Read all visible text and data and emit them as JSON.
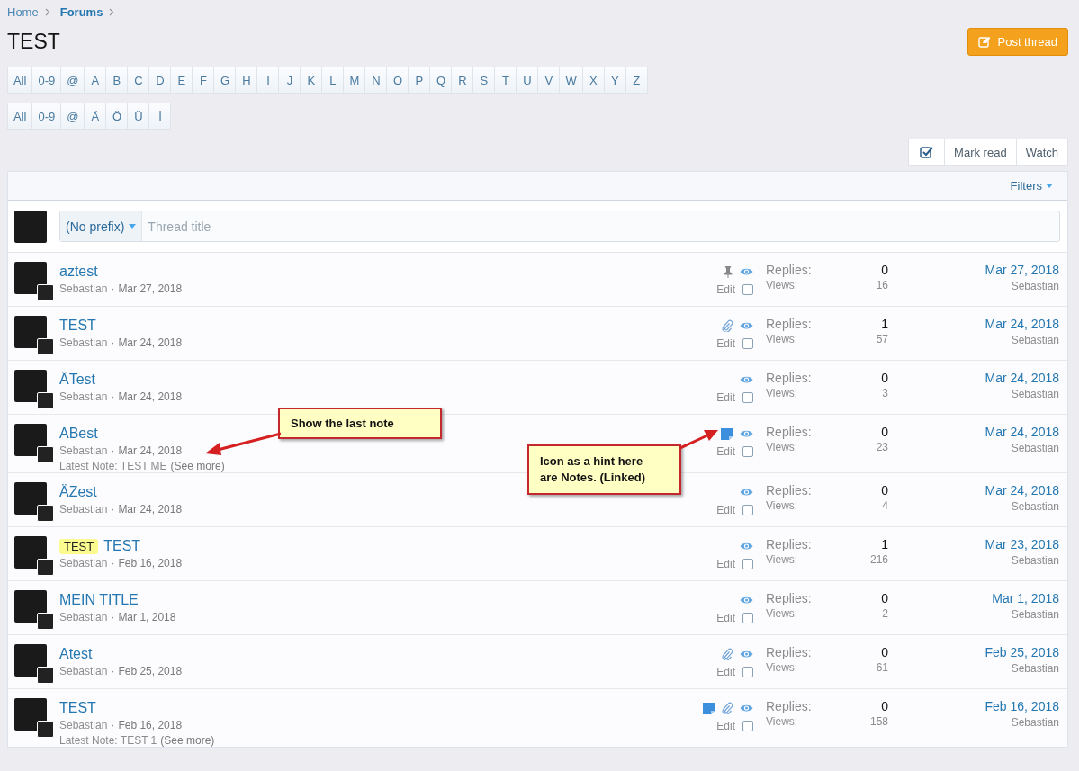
{
  "breadcrumb": [
    {
      "label": "Home",
      "current": false
    },
    {
      "label": "Forums",
      "current": true
    }
  ],
  "title": "TEST",
  "post_button": "Post thread",
  "letter_rows": [
    [
      "All",
      "0-9",
      "@",
      "A",
      "B",
      "C",
      "D",
      "E",
      "F",
      "G",
      "H",
      "I",
      "J",
      "K",
      "L",
      "M",
      "N",
      "O",
      "P",
      "Q",
      "R",
      "S",
      "T",
      "U",
      "V",
      "W",
      "X",
      "Y",
      "Z"
    ],
    [
      "All",
      "0-9",
      "@",
      "Ä",
      "Ö",
      "Ü",
      "İ"
    ]
  ],
  "toolbar": {
    "mark_read": "Mark read",
    "watch": "Watch"
  },
  "filters": "Filters",
  "new_thread": {
    "prefix": "(No prefix)",
    "placeholder": "Thread title"
  },
  "threads": [
    {
      "title": "aztest",
      "author": "Sebastian",
      "separator": "·",
      "date": "Mar 27, 2018",
      "pinned": true,
      "has_attachment": false,
      "has_note": false,
      "edit": "Edit",
      "checked": false,
      "replies_label": "Replies:",
      "replies": "0",
      "views_label": "Views:",
      "views": "16",
      "last_date": "Mar 27, 2018",
      "last_user": "Sebastian"
    },
    {
      "title": "TEST",
      "author": "Sebastian",
      "separator": "·",
      "date": "Mar 24, 2018",
      "pinned": false,
      "has_attachment": true,
      "has_note": false,
      "edit": "Edit",
      "checked": false,
      "replies_label": "Replies:",
      "replies": "1",
      "views_label": "Views:",
      "views": "57",
      "last_date": "Mar 24, 2018",
      "last_user": "Sebastian"
    },
    {
      "title": "ÄTest",
      "author": "Sebastian",
      "separator": "·",
      "date": "Mar 24, 2018",
      "pinned": false,
      "has_attachment": false,
      "has_note": false,
      "edit": "Edit",
      "checked": false,
      "replies_label": "Replies:",
      "replies": "0",
      "views_label": "Views:",
      "views": "3",
      "last_date": "Mar 24, 2018",
      "last_user": "Sebastian"
    },
    {
      "title": "ABest",
      "author": "Sebastian",
      "separator": "·",
      "date": "Mar 24, 2018",
      "note": {
        "text": "Latest Note: TEST ME",
        "link": "(See more)"
      },
      "pinned": false,
      "has_attachment": false,
      "has_note": true,
      "edit": "Edit",
      "checked": false,
      "replies_label": "Replies:",
      "replies": "0",
      "views_label": "Views:",
      "views": "23",
      "last_date": "Mar 24, 2018",
      "last_user": "Sebastian"
    },
    {
      "title": "ÄZest",
      "author": "Sebastian",
      "separator": "·",
      "date": "Mar 24, 2018",
      "pinned": false,
      "has_attachment": false,
      "has_note": false,
      "edit": "Edit",
      "checked": false,
      "replies_label": "Replies:",
      "replies": "0",
      "views_label": "Views:",
      "views": "4",
      "last_date": "Mar 24, 2018",
      "last_user": "Sebastian"
    },
    {
      "prefix": "TEST",
      "title": "TEST",
      "author": "Sebastian",
      "separator": "·",
      "date": "Feb 16, 2018",
      "pinned": false,
      "has_attachment": false,
      "has_note": false,
      "edit": "Edit",
      "checked": false,
      "replies_label": "Replies:",
      "replies": "1",
      "views_label": "Views:",
      "views": "216",
      "last_date": "Mar 23, 2018",
      "last_user": "Sebastian"
    },
    {
      "title": "MEIN TITLE",
      "author": "Sebastian",
      "separator": "·",
      "date": "Mar 1, 2018",
      "pinned": false,
      "has_attachment": false,
      "has_note": false,
      "edit": "Edit",
      "checked": false,
      "replies_label": "Replies:",
      "replies": "0",
      "views_label": "Views:",
      "views": "2",
      "last_date": "Mar 1, 2018",
      "last_user": "Sebastian"
    },
    {
      "title": "Atest",
      "author": "Sebastian",
      "separator": "·",
      "date": "Feb 25, 2018",
      "pinned": false,
      "has_attachment": true,
      "has_note": false,
      "edit": "Edit",
      "checked": false,
      "replies_label": "Replies:",
      "replies": "0",
      "views_label": "Views:",
      "views": "61",
      "last_date": "Feb 25, 2018",
      "last_user": "Sebastian"
    },
    {
      "title": "TEST",
      "author": "Sebastian",
      "separator": "·",
      "date": "Feb 16, 2018",
      "note": {
        "text": "Latest Note: TEST 1",
        "link": "(See more)"
      },
      "pinned": false,
      "has_attachment": true,
      "has_note": true,
      "edit": "Edit",
      "checked": false,
      "replies_label": "Replies:",
      "replies": "0",
      "views_label": "Views:",
      "views": "158",
      "last_date": "Feb 16, 2018",
      "last_user": "Sebastian"
    }
  ],
  "callouts": [
    {
      "text": "Show the last note"
    },
    {
      "text": "Icon as a hint here are Notes. (Linked)"
    }
  ]
}
